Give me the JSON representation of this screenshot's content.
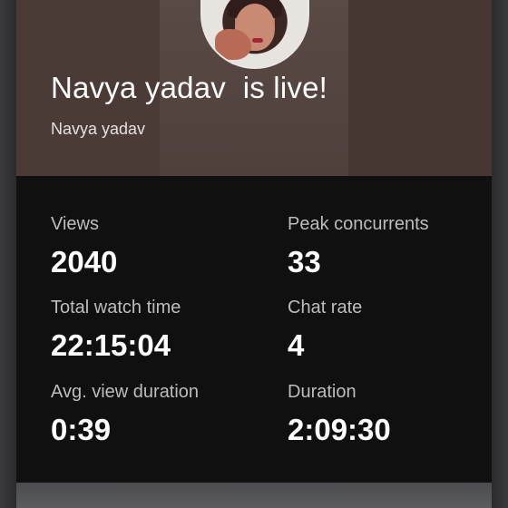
{
  "header": {
    "title": "Navya yadav  is live!",
    "channel_name": "Navya yadav"
  },
  "stats": [
    {
      "label": "Views",
      "value": "2040"
    },
    {
      "label": "Peak concurrents",
      "value": "33"
    },
    {
      "label": "Total watch time",
      "value": "22:15:04"
    },
    {
      "label": "Chat rate",
      "value": "4"
    },
    {
      "label": "Avg. view duration",
      "value": "0:39"
    },
    {
      "label": "Duration",
      "value": "2:09:30"
    }
  ]
}
